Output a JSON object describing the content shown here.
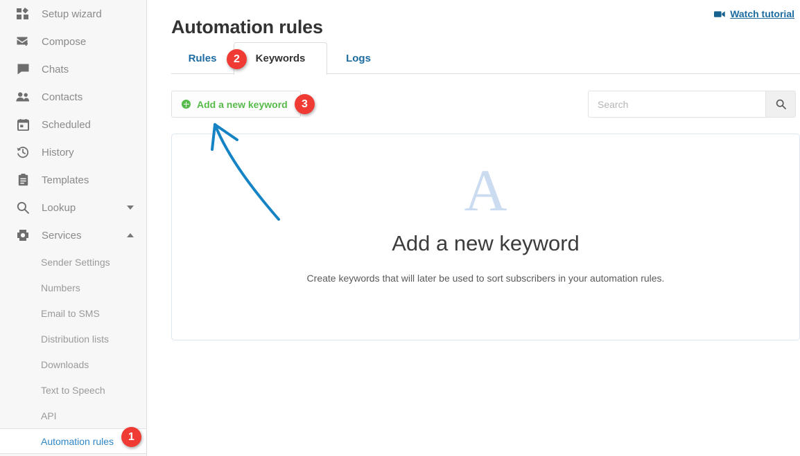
{
  "sidebar": {
    "items": [
      {
        "label": "Setup wizard",
        "icon": "dashboard-icon",
        "caret": ""
      },
      {
        "label": "Compose",
        "icon": "compose-icon",
        "caret": ""
      },
      {
        "label": "Chats",
        "icon": "chat-icon",
        "caret": ""
      },
      {
        "label": "Contacts",
        "icon": "contacts-icon",
        "caret": ""
      },
      {
        "label": "Scheduled",
        "icon": "calendar-icon",
        "caret": ""
      },
      {
        "label": "History",
        "icon": "history-icon",
        "caret": ""
      },
      {
        "label": "Templates",
        "icon": "templates-icon",
        "caret": ""
      },
      {
        "label": "Lookup",
        "icon": "search-icon",
        "caret": "down"
      },
      {
        "label": "Services",
        "icon": "gear-icon",
        "caret": "up"
      }
    ],
    "subitems": [
      {
        "label": "Sender Settings",
        "active": false
      },
      {
        "label": "Numbers",
        "active": false
      },
      {
        "label": "Email to SMS",
        "active": false
      },
      {
        "label": "Distribution lists",
        "active": false
      },
      {
        "label": "Downloads",
        "active": false
      },
      {
        "label": "Text to Speech",
        "active": false
      },
      {
        "label": "API",
        "active": false
      },
      {
        "label": "Automation rules",
        "active": true
      }
    ]
  },
  "header": {
    "title": "Automation rules",
    "watch_tutorial": "Watch tutorial"
  },
  "tabs": [
    {
      "label": "Rules",
      "active": false
    },
    {
      "label": "Keywords",
      "active": true
    },
    {
      "label": "Logs",
      "active": false
    }
  ],
  "toolbar": {
    "add_keyword_label": "Add a new keyword",
    "search_placeholder": "Search",
    "search_value": ""
  },
  "empty_state": {
    "glyph": "A",
    "title": "Add a new keyword",
    "description": "Create keywords that will later be used to sort subscribers in your automation rules."
  },
  "annotations": {
    "badges": [
      {
        "number": "1"
      },
      {
        "number": "2"
      },
      {
        "number": "3"
      }
    ],
    "arrow_color": "#1683c4"
  },
  "colors": {
    "accent_blue": "#1c6ca1",
    "link_blue": "#2f86c5",
    "green": "#57bb4a",
    "badge_red": "#ef3b33",
    "sidebar_bg": "#f7f7f7",
    "glyph_blue": "#ccdcf0"
  }
}
